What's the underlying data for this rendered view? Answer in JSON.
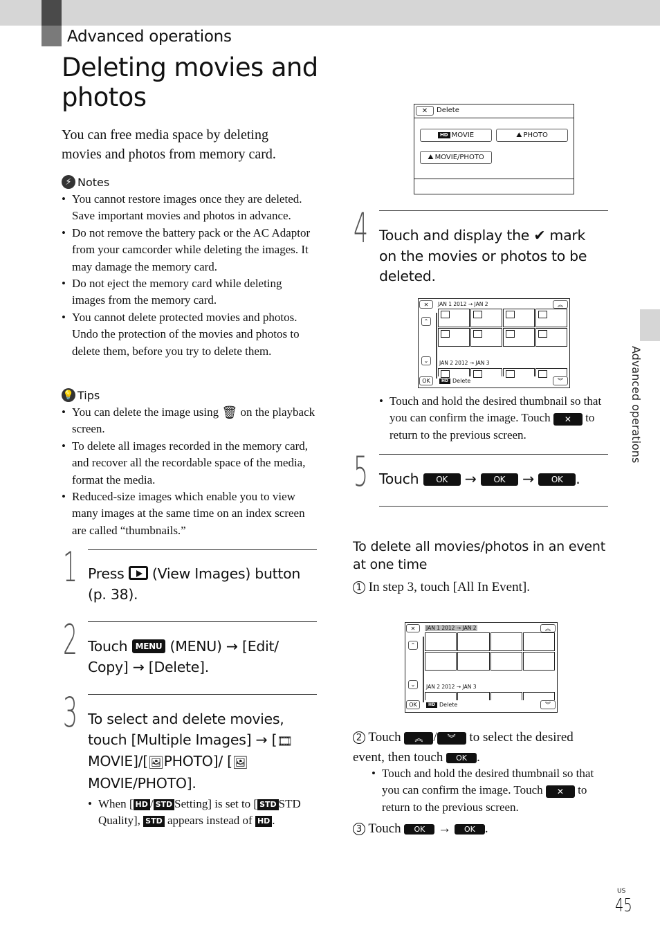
{
  "header": {
    "section_label": "Advanced operations",
    "title": "Deleting movies and photos"
  },
  "intro": "You can free media space by deleting movies and photos from memory card.",
  "notes": {
    "label": "Notes",
    "items": [
      "You cannot restore images once they are deleted. Save important movies and photos in advance.",
      "Do not remove the battery pack or the AC Adaptor from your camcorder while deleting the images. It may damage the memory card.",
      "Do not eject the memory card while deleting images from the memory card.",
      "You cannot delete protected movies and photos. Undo the protection of the movies and photos to delete them, before you try to delete them."
    ]
  },
  "tips": {
    "label": "Tips",
    "item1_before": "You can delete the image using",
    "item1_after": "on the playback screen.",
    "items": [
      "To delete all images recorded in the memory card, and recover all the recordable space of the media, format the media.",
      "Reduced-size images which enable you to view many images at the same time on an index screen are called “thumbnails.”"
    ]
  },
  "steps": {
    "s1": {
      "num": "1",
      "pre": "Press",
      "post": "(View Images) button (p. 38)."
    },
    "s2": {
      "num": "2",
      "pre": "Touch",
      "menu": "MENU",
      "post": "(MENU) → [Edit/ Copy] → [Delete]."
    },
    "s3": {
      "num": "3",
      "line1": "To select and delete movies, touch [Multiple Images] →",
      "movie": "MOVIE]/[",
      "photo": "PHOTO]/",
      "moviephoto": "MOVIE/PHOTO].",
      "note_when": "When [",
      "note_setting": "Setting] is set to [",
      "note_std": "STD Quality],",
      "note_appears": "appears instead of",
      "hd": "HD",
      "std": "STD"
    },
    "s4": {
      "num": "4",
      "text_pre": "Touch and display the",
      "check": "✔",
      "text_post": "mark on the movies or photos to be deleted.",
      "note": "Touch and hold the desired thumbnail so that you can confirm the image. Touch",
      "note_post": "to return to the previous screen."
    },
    "s5": {
      "num": "5",
      "pre": "Touch",
      "ok": "OK",
      "arrow": "→"
    }
  },
  "screen_delete": {
    "close": "✕",
    "title": "Delete",
    "movie": "MOVIE",
    "photo": "PHOTO",
    "moviephoto": "MOVIE/PHOTO"
  },
  "screen_index": {
    "close": "✕",
    "event1": "JAN 1 2012  →  JAN 2",
    "event2": "JAN 2 2012  →  JAN 3",
    "ok": "OK",
    "footer": "Delete",
    "hd": "HD"
  },
  "event_section": {
    "heading": "To delete all movies/photos in an event at one time",
    "step1": "In step 3, touch [All In Event].",
    "step2_pre": "Touch",
    "step2_mid": "to select the desired event, then touch",
    "step2_note": "Touch and hold the desired thumbnail so that you can confirm the image. Touch",
    "step2_note_post": "to return to the previous screen.",
    "step3_pre": "Touch",
    "n1": "1",
    "n2": "2",
    "n3": "3",
    "ok": "OK",
    "x": "✕",
    "up": "︽",
    "down": "︾"
  },
  "side_tab": "Advanced operations",
  "page": {
    "region": "US",
    "number": "45"
  }
}
